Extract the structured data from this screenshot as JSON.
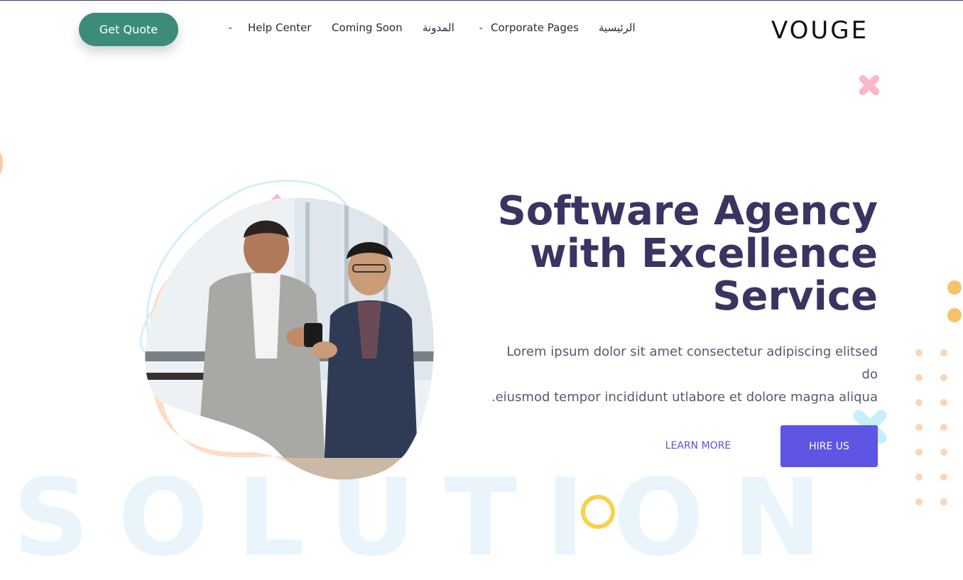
{
  "header": {
    "cta_label": "Get Quote",
    "nav": [
      {
        "label": "Help Center",
        "has_dropdown": true
      },
      {
        "label": "Coming Soon",
        "has_dropdown": false
      },
      {
        "label": "المدونة",
        "has_dropdown": false
      },
      {
        "label": "Corporate Pages",
        "has_dropdown": true
      },
      {
        "label": "الرئيسية",
        "has_dropdown": false
      }
    ],
    "logo_text": "VOUGE",
    "chevron_icon": "chevron-down-icon"
  },
  "hero": {
    "title_line1": "Software Agency",
    "title_line2": "with Excellence",
    "title_line3": "Service",
    "description_line1": "Lorem ipsum dolor sit amet consectetur adipiscing elitsed",
    "description_line2": "do",
    "description_line3": ".eiusmod tempor incididunt utlabore et dolore magna aliqua",
    "learn_more_label": "LEARN MORE",
    "hire_us_label": "HIRE US",
    "image_alt_icon": "business-people-photo"
  },
  "colors": {
    "accent": "#5e55e4",
    "cta": "#3c8c7c",
    "title": "#3a3462",
    "peach": "#fddcc7",
    "orange": "#f8c26a",
    "pink": "#f9b8c4",
    "light_blue": "#c7eef9"
  },
  "background": {
    "watermark_text": "SOLUTION"
  }
}
